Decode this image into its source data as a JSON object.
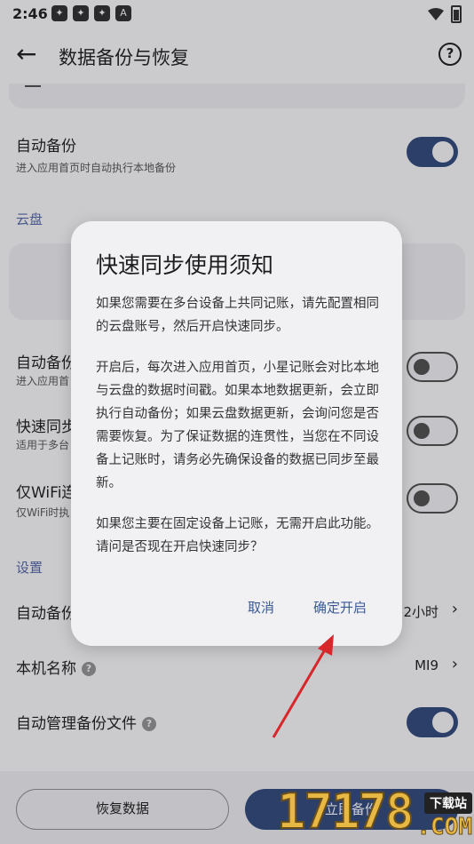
{
  "status": {
    "time": "2:46",
    "notif_icons": [
      "app-icon",
      "app-icon",
      "app-icon",
      "A"
    ]
  },
  "appbar": {
    "title": "数据备份与恢复"
  },
  "settings": {
    "auto_backup": {
      "title": "自动备份",
      "subtitle": "进入应用首页时自动执行本地备份"
    },
    "cloud_section": "云盘",
    "cloud_auto_backup": {
      "title": "自动备份",
      "subtitle": "进入应用首"
    },
    "quick_sync": {
      "title": "快速同步",
      "subtitle": "适用于多台"
    },
    "wifi_only": {
      "title": "仅WiFi连",
      "subtitle": "仅WiFi时执"
    },
    "settings_section": "设置",
    "auto_backup_interval": {
      "title": "自动备份",
      "value": "2小时"
    },
    "device_name": {
      "title": "本机名称",
      "value": "MI9"
    },
    "auto_manage": {
      "title": "自动管理备份文件"
    }
  },
  "bottom": {
    "restore_label": "恢复数据",
    "backup_label": "立即备份"
  },
  "dialog": {
    "title": "快速同步使用须知",
    "paragraphs": [
      "如果您需要在多台设备上共同记账，请先配置相同的云盘账号，然后开启快速同步。",
      "开启后，每次进入应用首页，小星记账会对比本地与云盘的数据时间戳。如果本地数据更新，会立即执行自动备份；如果云盘数据更新，会询问您是否需要恢复。为了保证数据的连贯性，当您在不同设备上记账时，请务必先确保设备的数据已同步至最新。",
      "如果您主要在固定设备上记账，无需开启此功能。请问是否现在开启快速同步？"
    ],
    "cancel_label": "取消",
    "confirm_label": "确定开启"
  },
  "watermark": {
    "number": "17178",
    "badge": "下载站",
    "domain": ".COM"
  },
  "colors": {
    "accent": "#2b3f68",
    "dialog_link": "#3a5a95",
    "arrow": "#d8262a"
  }
}
